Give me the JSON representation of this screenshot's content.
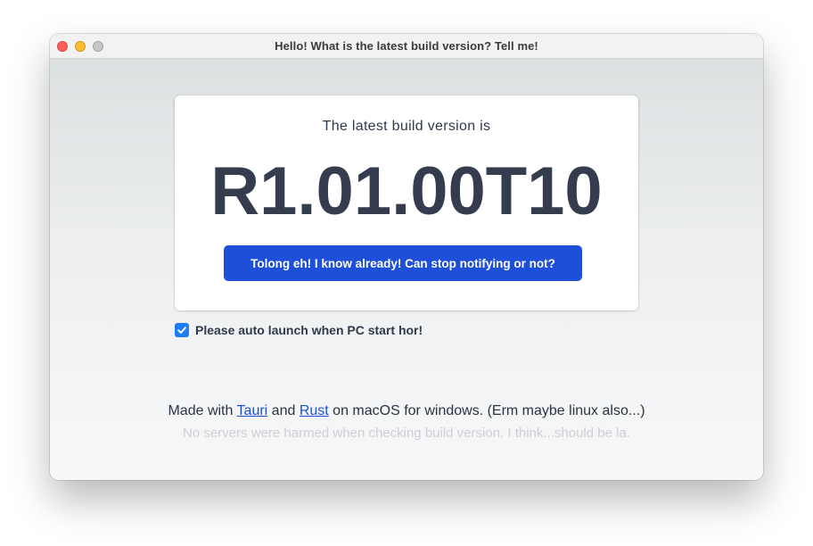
{
  "window": {
    "title": "Hello! What is the latest build version? Tell me!"
  },
  "card": {
    "subtitle": "The latest build version is",
    "version": "R1.01.00T10",
    "button_label": "Tolong eh! I know already! Can stop notifying or not?"
  },
  "autolaunch": {
    "checked": true,
    "label": "Please auto launch when PC start hor!"
  },
  "footer": {
    "prefix": "Made with ",
    "link1": "Tauri",
    "middle": " and ",
    "link2": "Rust",
    "suffix": " on macOS for windows. (Erm maybe linux also...)",
    "note": "No servers were harmed when checking build version. I think...should be la."
  },
  "colors": {
    "accent": "#1d4fd8",
    "checkbox": "#1f7cf4",
    "text": "#343c4d"
  }
}
